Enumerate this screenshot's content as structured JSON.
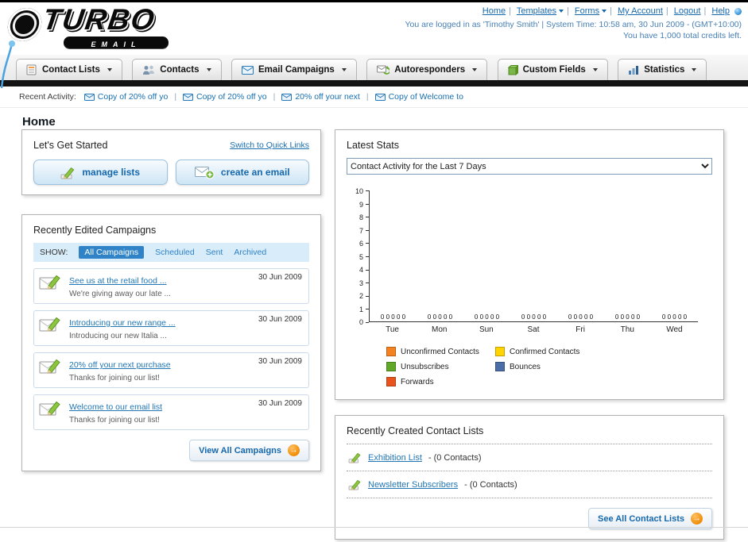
{
  "header": {
    "logo_title": "TURBO",
    "logo_subtitle": "EMAIL",
    "links": {
      "home": "Home",
      "templates": "Templates",
      "forms": "Forms",
      "my_account": "My Account",
      "logout": "Logout",
      "help": "Help"
    },
    "login_info": "You are logged in as 'Timothy Smith' | System Time: 10:58 am, 30 Jun 2009 - (GMT+10:00)",
    "credits_info": "You have 1,000 total credits left."
  },
  "nav": {
    "contact_lists": "Contact Lists",
    "contacts": "Contacts",
    "email_campaigns": "Email Campaigns",
    "autoresponders": "Autoresponders",
    "custom_fields": "Custom Fields",
    "statistics": "Statistics"
  },
  "recent_activity": {
    "label": "Recent Activity:",
    "items": [
      "Copy of 20% off yo",
      "Copy of 20% off yo",
      "20% off your next",
      "Copy of Welcome to"
    ]
  },
  "page_title": "Home",
  "get_started": {
    "title": "Let's Get Started",
    "switch_link": "Switch to Quick Links",
    "manage_lists_label": "manage lists",
    "create_email_label": "create an email"
  },
  "campaigns": {
    "title": "Recently Edited Campaigns",
    "show_label": "SHOW:",
    "tabs": [
      "All Campaigns",
      "Scheduled",
      "Sent",
      "Archived"
    ],
    "items": [
      {
        "title": "See us at the retail food ...",
        "subtitle": "We're giving away our late ...",
        "date": "30 Jun 2009"
      },
      {
        "title": "Introducing our new range ...",
        "subtitle": "Introducing our new Italia ...",
        "date": "30 Jun 2009"
      },
      {
        "title": "20% off your next purchase",
        "subtitle": "Thanks for joining our list!",
        "date": "30 Jun 2009"
      },
      {
        "title": "Welcome to our email list",
        "subtitle": "Thanks for joining our list!",
        "date": "30 Jun 2009"
      }
    ],
    "view_all_label": "View All Campaigns"
  },
  "stats": {
    "title": "Latest Stats",
    "selected_option": "Contact Activity for the Last 7 Days",
    "zero_row": "0 0 0 0 0",
    "chart_data": {
      "type": "bar",
      "title": "Contact Activity for the Last 7 Days",
      "categories": [
        "Tue",
        "Mon",
        "Sun",
        "Sat",
        "Fri",
        "Thu",
        "Wed"
      ],
      "series": [
        {
          "name": "Unconfirmed Contacts",
          "color": "#F58220",
          "values": [
            0,
            0,
            0,
            0,
            0,
            0,
            0
          ]
        },
        {
          "name": "Confirmed Contacts",
          "color": "#FFD400",
          "values": [
            0,
            0,
            0,
            0,
            0,
            0,
            0
          ]
        },
        {
          "name": "Unsubscribes",
          "color": "#61A828",
          "values": [
            0,
            0,
            0,
            0,
            0,
            0,
            0
          ]
        },
        {
          "name": "Bounces",
          "color": "#4B6EA8",
          "values": [
            0,
            0,
            0,
            0,
            0,
            0,
            0
          ]
        },
        {
          "name": "Forwards",
          "color": "#E8541E",
          "values": [
            0,
            0,
            0,
            0,
            0,
            0,
            0
          ]
        }
      ],
      "ylim": [
        0,
        10
      ],
      "yticks": [
        "0",
        "1",
        "2",
        "3",
        "4",
        "5",
        "6",
        "7",
        "8",
        "9",
        "10"
      ],
      "grid": false,
      "legend_position": "bottom"
    }
  },
  "contact_lists": {
    "title": "Recently Created Contact Lists",
    "items": [
      {
        "name": "Exhibition List",
        "detail": "- (0 Contacts)"
      },
      {
        "name": "Newsletter Subscribers",
        "detail": "- (0 Contacts)"
      }
    ],
    "see_all_label": "See All Contact Lists"
  }
}
